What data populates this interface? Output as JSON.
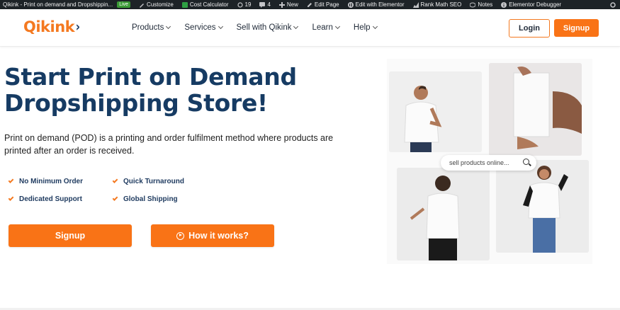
{
  "adminbar": {
    "site_title": "Qikink - Print on demand and Dropshippin...",
    "live_badge": "Live",
    "customize": "Customize",
    "cost_calculator": "Cost Calculator",
    "updates_count": "19",
    "comments_count": "4",
    "new": "New",
    "edit_page": "Edit Page",
    "edit_elementor": "Edit with Elementor",
    "rank_math": "Rank Math SEO",
    "notes": "Notes",
    "elementor_debugger": "Elementor Debugger"
  },
  "header": {
    "logo_text": "Qikink",
    "logo_mark": "›",
    "nav": [
      {
        "label": "Products"
      },
      {
        "label": "Services"
      },
      {
        "label": "Sell with Qikink"
      },
      {
        "label": "Learn"
      },
      {
        "label": "Help"
      }
    ],
    "login_label": "Login",
    "signup_label": "Signup"
  },
  "hero": {
    "title_line1": "Start Print on Demand",
    "title_line2": "Dropshipping Store!",
    "description": "Print on demand (POD) is a printing and order fulfilment method where products are printed after an order is received.",
    "features": [
      "No Minimum Order",
      "Quick Turnaround",
      "Dedicated Support",
      "Global Shipping"
    ],
    "signup_button": "Signup",
    "how_button": "How it works?"
  },
  "collage": {
    "search_text": "sell products online..."
  },
  "colors": {
    "accent": "#f97316",
    "navy": "#163b63",
    "adminbar": "#1d2327"
  }
}
